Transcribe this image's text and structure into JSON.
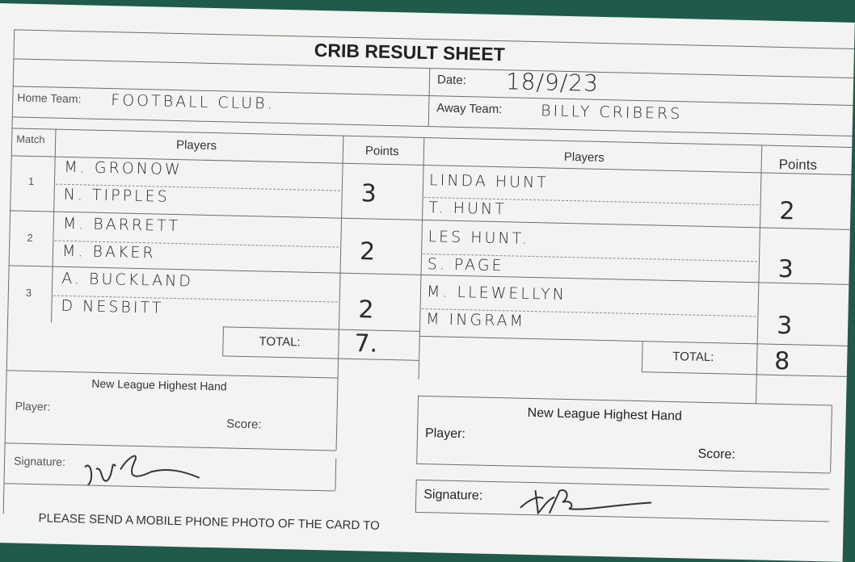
{
  "sheet": {
    "title": "CRIB RESULT SHEET",
    "date_label": "Date:",
    "date_value": "18/9/23",
    "home_label": "Home Team:",
    "home_value": "FOOTBALL CLUB.",
    "away_label": "Away Team:",
    "away_value": "BILLY CRIBERS"
  },
  "table": {
    "match_header": "Match",
    "players_header": "Players",
    "points_header": "Points",
    "away_players_header": "Players",
    "away_points_header": "Points",
    "rows": [
      {
        "match": "1",
        "home_players": [
          "M. GRONOW",
          "N. TIPPLES"
        ],
        "home_points": "3",
        "away_players": [
          "LINDA HUNT",
          "T. HUNT"
        ],
        "away_points": "2"
      },
      {
        "match": "2",
        "home_players": [
          "M. BARRETT",
          "M. BAKER"
        ],
        "home_points": "2",
        "away_players": [
          "LES HUNT.",
          "S. PAGE"
        ],
        "away_points": "3"
      },
      {
        "match": "3",
        "home_players": [
          "A. BUCKLAND",
          "D NESBITT"
        ],
        "home_points": "2",
        "away_players": [
          "M. LLEWELLYN",
          "M INGRAM"
        ],
        "away_points": "3"
      }
    ],
    "home_total_label": "TOTAL:",
    "home_total_value": "7.",
    "away_total_label": "TOTAL:",
    "away_total_value": "8"
  },
  "highest_hand": {
    "home": {
      "title": "New League Highest Hand",
      "player_label": "Player:",
      "score_label": "Score:",
      "signature_label": "Signature:"
    },
    "away": {
      "title": "New League Highest Hand",
      "player_label": "Player:",
      "score_label": "Score:",
      "signature_label": "Signature:"
    }
  },
  "footer": {
    "text": "PLEASE SEND A MOBILE PHONE PHOTO OF THE CARD TO"
  }
}
